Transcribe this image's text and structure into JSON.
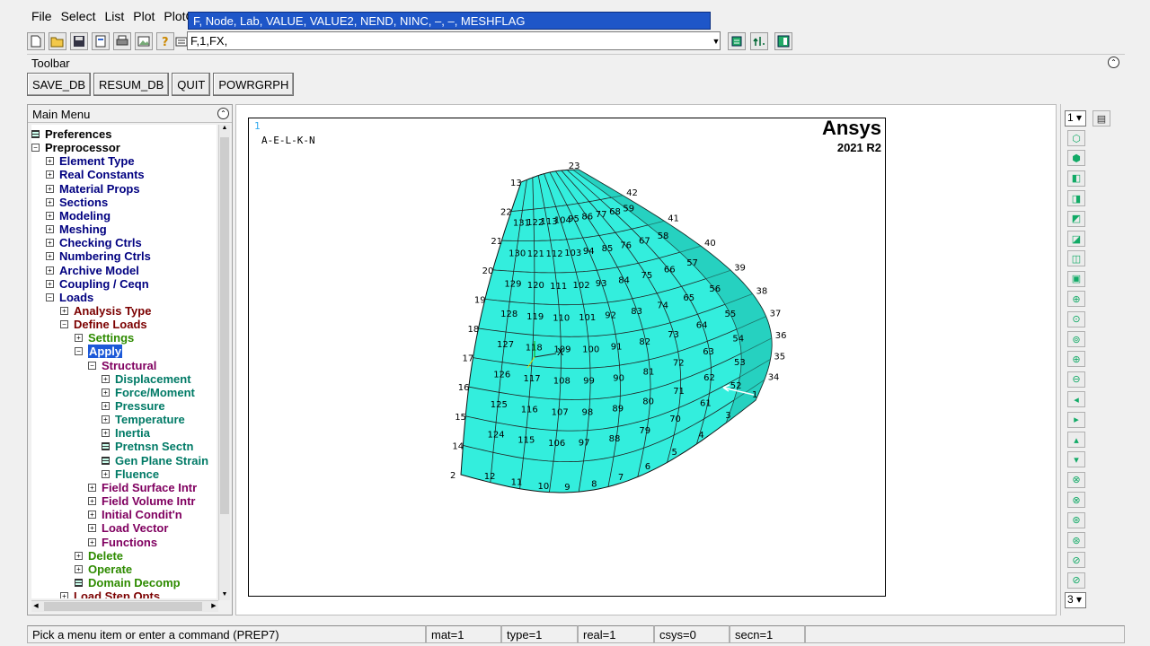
{
  "menubar": {
    "items": [
      "File",
      "Select",
      "List",
      "Plot",
      "PlotC"
    ]
  },
  "command": {
    "value": "F,1,FX,",
    "hint": "F, Node, Lab, VALUE, VALUE2, NEND, NINC, –, –, MESHFLAG"
  },
  "toolbar": {
    "title": "Toolbar",
    "buttons": [
      "SAVE_DB",
      "RESUM_DB",
      "QUIT",
      "POWRGRPH"
    ]
  },
  "main_menu": {
    "title": "Main Menu",
    "items": [
      {
        "label": "Preferences",
        "level": 0,
        "icon": "grid",
        "color": "blk"
      },
      {
        "label": "Preprocessor",
        "level": 0,
        "icon": "minus",
        "color": "blk"
      },
      {
        "label": "Element Type",
        "level": 1,
        "icon": "plus",
        "color": "nav"
      },
      {
        "label": "Real Constants",
        "level": 1,
        "icon": "plus",
        "color": "nav"
      },
      {
        "label": "Material Props",
        "level": 1,
        "icon": "plus",
        "color": "nav"
      },
      {
        "label": "Sections",
        "level": 1,
        "icon": "plus",
        "color": "nav"
      },
      {
        "label": "Modeling",
        "level": 1,
        "icon": "plus",
        "color": "nav"
      },
      {
        "label": "Meshing",
        "level": 1,
        "icon": "plus",
        "color": "nav"
      },
      {
        "label": "Checking Ctrls",
        "level": 1,
        "icon": "plus",
        "color": "nav"
      },
      {
        "label": "Numbering Ctrls",
        "level": 1,
        "icon": "plus",
        "color": "nav"
      },
      {
        "label": "Archive Model",
        "level": 1,
        "icon": "plus",
        "color": "nav"
      },
      {
        "label": "Coupling / Ceqn",
        "level": 1,
        "icon": "plus",
        "color": "nav"
      },
      {
        "label": "Loads",
        "level": 1,
        "icon": "minus",
        "color": "nav"
      },
      {
        "label": "Analysis Type",
        "level": 2,
        "icon": "plus",
        "color": "red"
      },
      {
        "label": "Define Loads",
        "level": 2,
        "icon": "minus",
        "color": "red"
      },
      {
        "label": "Settings",
        "level": 3,
        "icon": "plus",
        "color": "grn"
      },
      {
        "label": "Apply",
        "level": 3,
        "icon": "minus",
        "color": "sel"
      },
      {
        "label": "Structural",
        "level": 4,
        "icon": "minus",
        "color": "pur"
      },
      {
        "label": "Displacement",
        "level": 5,
        "icon": "plus",
        "color": "teal"
      },
      {
        "label": "Force/Moment",
        "level": 5,
        "icon": "plus",
        "color": "teal"
      },
      {
        "label": "Pressure",
        "level": 5,
        "icon": "plus",
        "color": "teal"
      },
      {
        "label": "Temperature",
        "level": 5,
        "icon": "plus",
        "color": "teal"
      },
      {
        "label": "Inertia",
        "level": 5,
        "icon": "plus",
        "color": "teal"
      },
      {
        "label": "Pretnsn Sectn",
        "level": 5,
        "icon": "grid",
        "color": "teal"
      },
      {
        "label": "Gen Plane Strain",
        "level": 5,
        "icon": "grid",
        "color": "teal"
      },
      {
        "label": "Fluence",
        "level": 5,
        "icon": "plus",
        "color": "teal"
      },
      {
        "label": "Field Surface Intr",
        "level": 4,
        "icon": "plus",
        "color": "pur"
      },
      {
        "label": "Field Volume Intr",
        "level": 4,
        "icon": "plus",
        "color": "pur"
      },
      {
        "label": "Initial Condit'n",
        "level": 4,
        "icon": "plus",
        "color": "pur"
      },
      {
        "label": "Load Vector",
        "level": 4,
        "icon": "plus",
        "color": "pur"
      },
      {
        "label": "Functions",
        "level": 4,
        "icon": "plus",
        "color": "pur"
      },
      {
        "label": "Delete",
        "level": 3,
        "icon": "plus",
        "color": "grn"
      },
      {
        "label": "Operate",
        "level": 3,
        "icon": "plus",
        "color": "grn"
      },
      {
        "label": "Domain Decomp",
        "level": 3,
        "icon": "grid",
        "color": "grn"
      },
      {
        "label": "Load Step Opts",
        "level": 2,
        "icon": "plus",
        "color": "red"
      }
    ]
  },
  "graphics": {
    "window_number": "1",
    "label": "A-E-L-K-N",
    "brand": "Ansys",
    "version": "2021 R2",
    "mesh_color": "#33eedd",
    "edge_node_labels": [
      "13",
      "22",
      "21",
      "20",
      "19",
      "18",
      "17",
      "16",
      "15",
      "14",
      "2",
      "12",
      "11",
      "10",
      "9",
      "8",
      "7",
      "6",
      "5",
      "4",
      "3",
      "1",
      "23",
      "34",
      "35",
      "36",
      "37",
      "38",
      "39",
      "40",
      "41",
      "42"
    ],
    "interior_labels": [
      "131",
      "130",
      "129",
      "128",
      "127",
      "126",
      "125",
      "124",
      "122",
      "121",
      "120",
      "119",
      "118",
      "117",
      "116",
      "115",
      "113",
      "112",
      "111",
      "110",
      "109",
      "108",
      "107",
      "106",
      "104",
      "103",
      "102",
      "101",
      "100",
      "99",
      "98",
      "97",
      "95",
      "94",
      "93",
      "92",
      "91",
      "90",
      "89",
      "88",
      "86",
      "85",
      "84",
      "83",
      "82",
      "81",
      "80",
      "79",
      "77",
      "76",
      "75",
      "74",
      "73",
      "72",
      "71",
      "70",
      "68",
      "67",
      "66",
      "65",
      "64",
      "63",
      "62",
      "61",
      "59",
      "58",
      "57",
      "56",
      "55",
      "54",
      "53",
      "52"
    ]
  },
  "right_toolbar": {
    "window_select": "1",
    "bottom_select": "3",
    "icons": [
      "iso-view-icon",
      "oblique-view-icon",
      "front-view-icon",
      "top-view-icon",
      "back-view-icon",
      "bottom-view-icon",
      "right-view-icon",
      "left-view-icon",
      "zoom-icon",
      "zoom-box-icon",
      "zoom-back-icon",
      "zoom-in-icon",
      "zoom-out-icon",
      "pan-left-icon",
      "pan-right-icon",
      "pan-up-icon",
      "pan-down-icon",
      "rotate-x-pos-icon",
      "rotate-x-neg-icon",
      "rotate-y-pos-icon",
      "rotate-y-neg-icon",
      "rotate-z-pos-icon",
      "rotate-z-neg-icon"
    ]
  },
  "status": {
    "prompt": "Pick a menu item or enter a command (PREP7)",
    "mat": "mat=1",
    "type": "type=1",
    "real": "real=1",
    "csys": "csys=0",
    "secn": "secn=1"
  }
}
